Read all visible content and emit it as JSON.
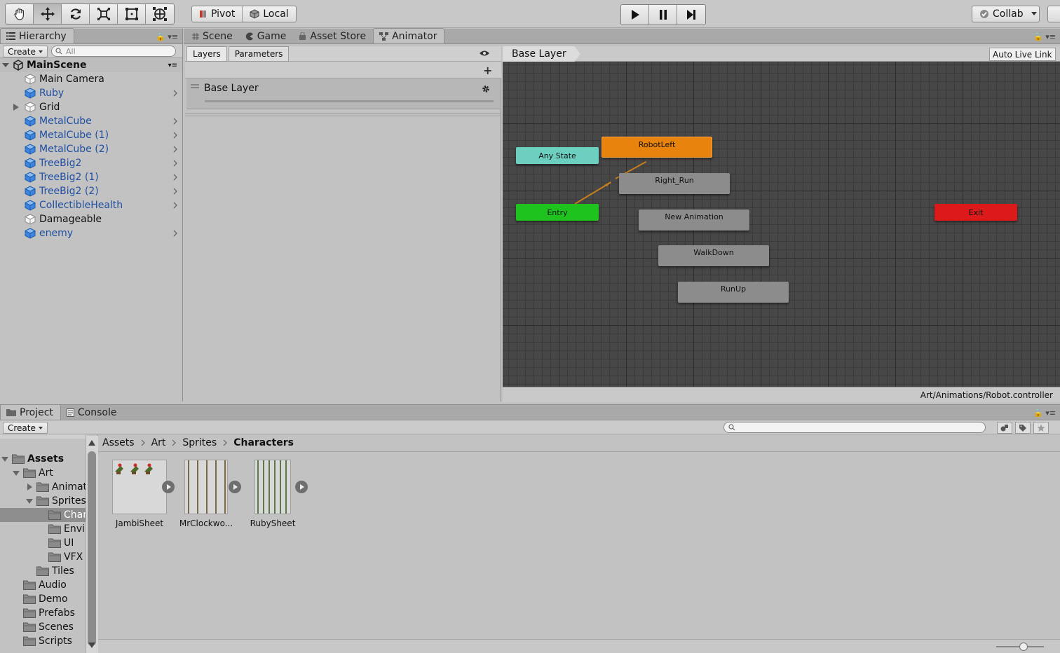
{
  "toolbar": {
    "pivot_label": "Pivot",
    "local_label": "Local",
    "collab_label": "Collab"
  },
  "hierarchy": {
    "tab_label": "Hierarchy",
    "create_label": "Create",
    "search_placeholder": "All",
    "scene_name": "MainScene",
    "items": [
      {
        "label": "Main Camera",
        "prefab": false,
        "arrow": false,
        "expand": false
      },
      {
        "label": "Ruby",
        "prefab": true,
        "arrow": true,
        "expand": false
      },
      {
        "label": "Grid",
        "prefab": false,
        "arrow": false,
        "expand": true
      },
      {
        "label": "MetalCube",
        "prefab": true,
        "arrow": true,
        "expand": false
      },
      {
        "label": "MetalCube (1)",
        "prefab": true,
        "arrow": true,
        "expand": false
      },
      {
        "label": "MetalCube (2)",
        "prefab": true,
        "arrow": true,
        "expand": false
      },
      {
        "label": "TreeBig2",
        "prefab": true,
        "arrow": true,
        "expand": false
      },
      {
        "label": "TreeBig2 (1)",
        "prefab": true,
        "arrow": true,
        "expand": false
      },
      {
        "label": "TreeBig2 (2)",
        "prefab": true,
        "arrow": true,
        "expand": false
      },
      {
        "label": "CollectibleHealth",
        "prefab": true,
        "arrow": true,
        "expand": false
      },
      {
        "label": "Damageable",
        "prefab": false,
        "arrow": false,
        "expand": false
      },
      {
        "label": "enemy",
        "prefab": true,
        "arrow": true,
        "expand": false
      }
    ]
  },
  "center_tabs": {
    "scene": "Scene",
    "game": "Game",
    "asset_store": "Asset Store",
    "animator": "Animator"
  },
  "animator": {
    "layers_tab": "Layers",
    "parameters_tab": "Parameters",
    "layer_name": "Base Layer",
    "breadcrumb": "Base Layer",
    "auto_live_link": "Auto Live Link",
    "controller_path": "Art/Animations/Robot.controller",
    "nodes": {
      "any_state": "Any State",
      "entry": "Entry",
      "exit": "Exit",
      "robot_left": "RobotLeft",
      "right_run": "Right_Run",
      "new_animation": "New Animation",
      "walk_down": "WalkDown",
      "run_up": "RunUp"
    },
    "colors": {
      "any_state": "#6ccfc0",
      "entry": "#1ec31e",
      "exit": "#dd1a1a",
      "default_state": "#e8830e",
      "state": "#8c8c8c",
      "transition": "#c77e1c"
    }
  },
  "project": {
    "tab_label": "Project",
    "console_label": "Console",
    "create_label": "Create",
    "breadcrumbs": [
      "Assets",
      "Art",
      "Sprites",
      "Characters"
    ],
    "tree": {
      "assets": "Assets",
      "art": "Art",
      "animations": "Animat",
      "sprites": "Sprites",
      "characters": "Char",
      "environment": "Envi",
      "ui": "UI",
      "vfx": "VFX",
      "tiles": "Tiles",
      "audio": "Audio",
      "demo": "Demo",
      "prefabs": "Prefabs",
      "scenes": "Scenes",
      "scripts": "Scripts"
    },
    "assets": [
      "JambiSheet",
      "MrClockwo...",
      "RubySheet"
    ]
  }
}
